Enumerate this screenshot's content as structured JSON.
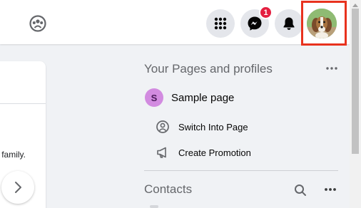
{
  "topbar": {
    "left_icon": "groups-icon",
    "menu_icon": "grid-menu-icon",
    "messenger_icon": "messenger-icon",
    "messenger_badge": "1",
    "notifications_icon": "bell-icon",
    "profile_icon": "profile-avatar-icon",
    "highlight_color": "#e8321e"
  },
  "feed": {
    "text": "family.",
    "next_icon": "chevron-right-icon"
  },
  "pages": {
    "title": "Your Pages and profiles",
    "more_icon": "more-horizontal-icon",
    "page": {
      "initial": "S",
      "name": "Sample page",
      "color": "#d28be0"
    },
    "actions": [
      {
        "label": "Switch Into Page",
        "icon": "switch-profile-icon"
      },
      {
        "label": "Create Promotion",
        "icon": "megaphone-icon"
      }
    ]
  },
  "contacts": {
    "title": "Contacts",
    "search_icon": "search-icon",
    "more_icon": "more-horizontal-icon"
  },
  "colors": {
    "background": "#f0f2f5",
    "badge": "#e41e3f",
    "secondary_text": "#65676b"
  }
}
